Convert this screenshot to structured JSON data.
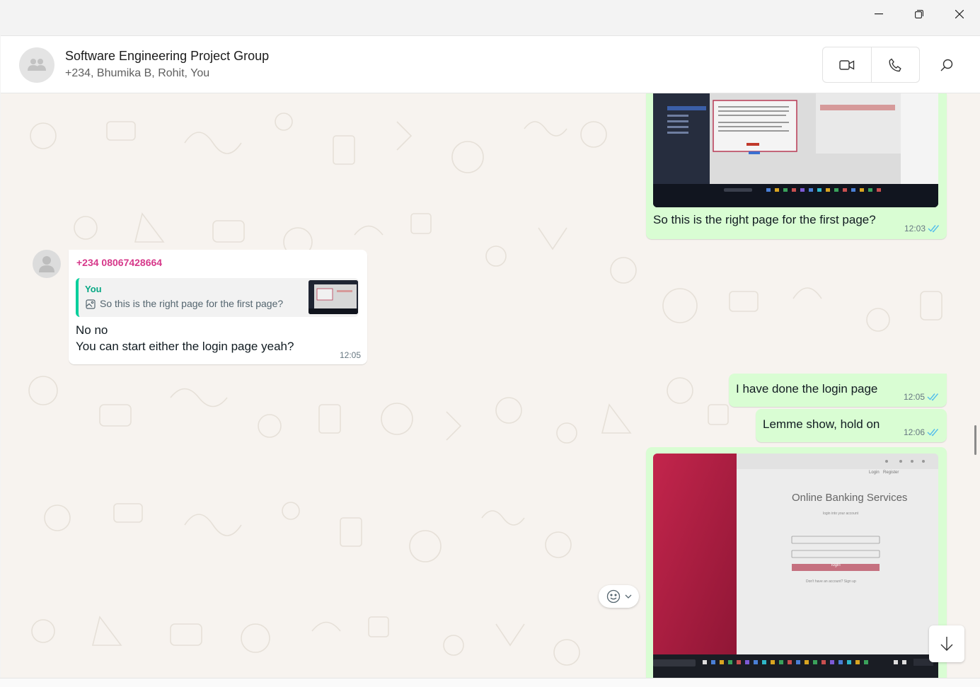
{
  "window": {
    "minimize_icon": "minimize-icon",
    "restore_icon": "restore-icon",
    "close_icon": "close-icon"
  },
  "header": {
    "title": "Software Engineering Project Group",
    "members": "+234, Bhumika B, Rohit, You",
    "video_call_icon": "video-call-icon",
    "voice_call_icon": "voice-call-icon",
    "search_icon": "search-icon"
  },
  "messages": [
    {
      "direction": "out",
      "image": "screenshot of a web page with window sidebar",
      "text": "So this is the right page for the first page?",
      "time": "12:03",
      "status": "read"
    },
    {
      "direction": "in",
      "sender": "+234 08067428664",
      "quote_author": "You",
      "quote_text": "So this is the right page for the first page?",
      "text_lines": [
        "No no",
        "You can start either the login page yeah?"
      ],
      "time": "12:05"
    },
    {
      "direction": "out",
      "text": "I have done the login page",
      "time": "12:05",
      "status": "read"
    },
    {
      "direction": "out",
      "text": "Lemme show, hold on",
      "time": "12:06",
      "status": "read"
    },
    {
      "direction": "out",
      "image": "photo of a laptop screen",
      "image_text": {
        "title": "Online Banking Services",
        "subtitle": "login into your account",
        "nav_login": "Login",
        "nav_register": "Register",
        "button": "login",
        "footer": "Don't have an account? Sign up"
      }
    }
  ],
  "controls": {
    "reaction_icon": "emoji-icon",
    "chevron_icon": "chevron-down-icon",
    "scroll_down_icon": "arrow-down-icon"
  },
  "colors": {
    "outgoing_bubble": "#d9fdd3",
    "incoming_bubble": "#ffffff",
    "sender_name": "#d6388a",
    "quote_accent": "#06cf9c",
    "read_ticks": "#53bdeb",
    "chat_background": "#f7f3ef"
  }
}
